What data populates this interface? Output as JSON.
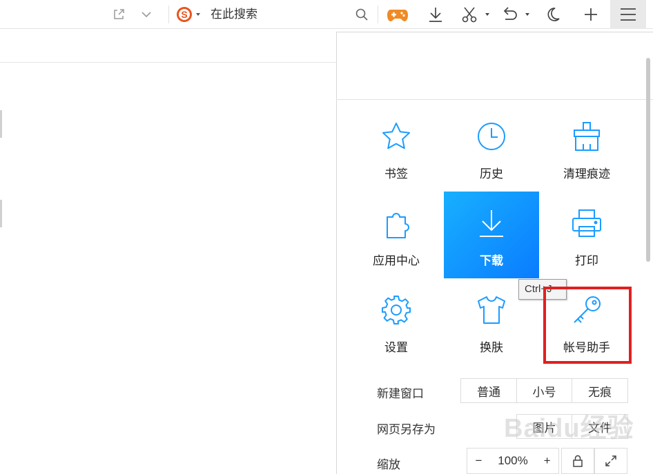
{
  "toolbar": {
    "search_placeholder": "在此搜索"
  },
  "menu": {
    "tiles": [
      {
        "label": "书签",
        "icon": "star-icon"
      },
      {
        "label": "历史",
        "icon": "clock-icon"
      },
      {
        "label": "清理痕迹",
        "icon": "broom-icon"
      },
      {
        "label": "应用中心",
        "icon": "puzzle-icon"
      },
      {
        "label": "下载",
        "icon": "download-icon"
      },
      {
        "label": "打印",
        "icon": "printer-icon"
      },
      {
        "label": "设置",
        "icon": "gear-icon"
      },
      {
        "label": "换肤",
        "icon": "shirt-icon"
      },
      {
        "label": "帐号助手",
        "icon": "key-icon"
      }
    ],
    "tooltip": "Ctrl+J",
    "new_window": {
      "label": "新建窗口",
      "options": [
        "普通",
        "小号",
        "无痕"
      ]
    },
    "save_as": {
      "label": "网页另存为",
      "options": [
        "图片",
        "文件"
      ]
    },
    "zoom": {
      "label": "缩放",
      "minus": "−",
      "value": "100%",
      "plus": "+"
    }
  },
  "watermark": "Baidu经验",
  "colors": {
    "accent": "#1a9cff",
    "highlight": "#e02020",
    "search_logo": "#e8541e",
    "game_icon": "#f08a24"
  }
}
